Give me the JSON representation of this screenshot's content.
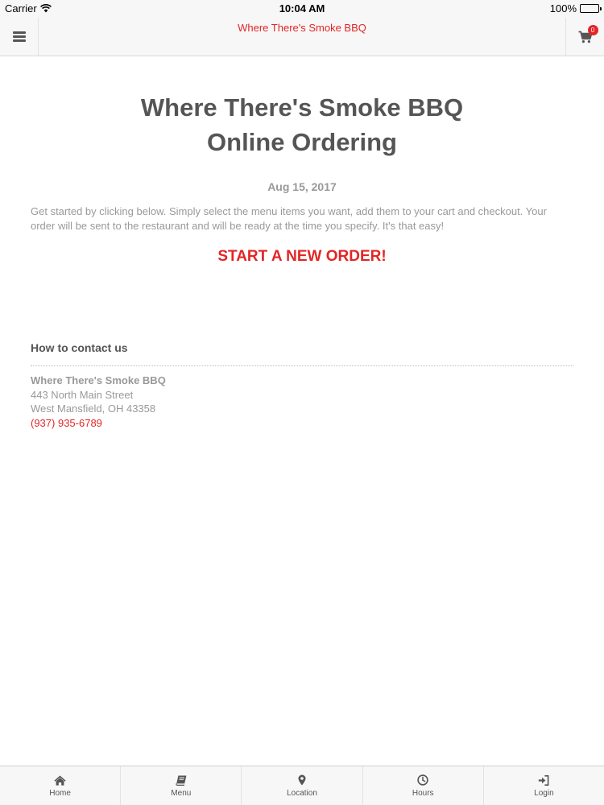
{
  "status_bar": {
    "carrier": "Carrier",
    "time": "10:04 AM",
    "battery": "100%"
  },
  "nav": {
    "title": "Where There's Smoke BBQ",
    "cart_count": "0",
    "menu_icon": "hamburger-icon",
    "cart_icon": "shopping-cart-icon"
  },
  "main": {
    "title_line1": "Where There's Smoke BBQ",
    "title_line2": "Online Ordering",
    "date": "Aug 15, 2017",
    "intro": "Get started by clicking below. Simply select the menu items you want, add them to your cart and checkout. Your order will be sent to the restaurant and will be ready at the time you specify. It's that easy!",
    "cta": "START A NEW ORDER!"
  },
  "contact": {
    "heading": "How to contact us",
    "name": "Where There's Smoke BBQ",
    "street": "443 North Main Street",
    "city": "West Mansfield, OH 43358",
    "phone": "(937) 935-6789"
  },
  "tabs": [
    {
      "label": "Home",
      "icon": "home-icon"
    },
    {
      "label": "Menu",
      "icon": "book-icon"
    },
    {
      "label": "Location",
      "icon": "map-pin-icon"
    },
    {
      "label": "Hours",
      "icon": "clock-icon"
    },
    {
      "label": "Login",
      "icon": "sign-in-icon"
    }
  ],
  "colors": {
    "accent": "#e32526",
    "text_dark": "#555555",
    "text_muted": "#999999",
    "bar_background": "#f7f7f7"
  }
}
